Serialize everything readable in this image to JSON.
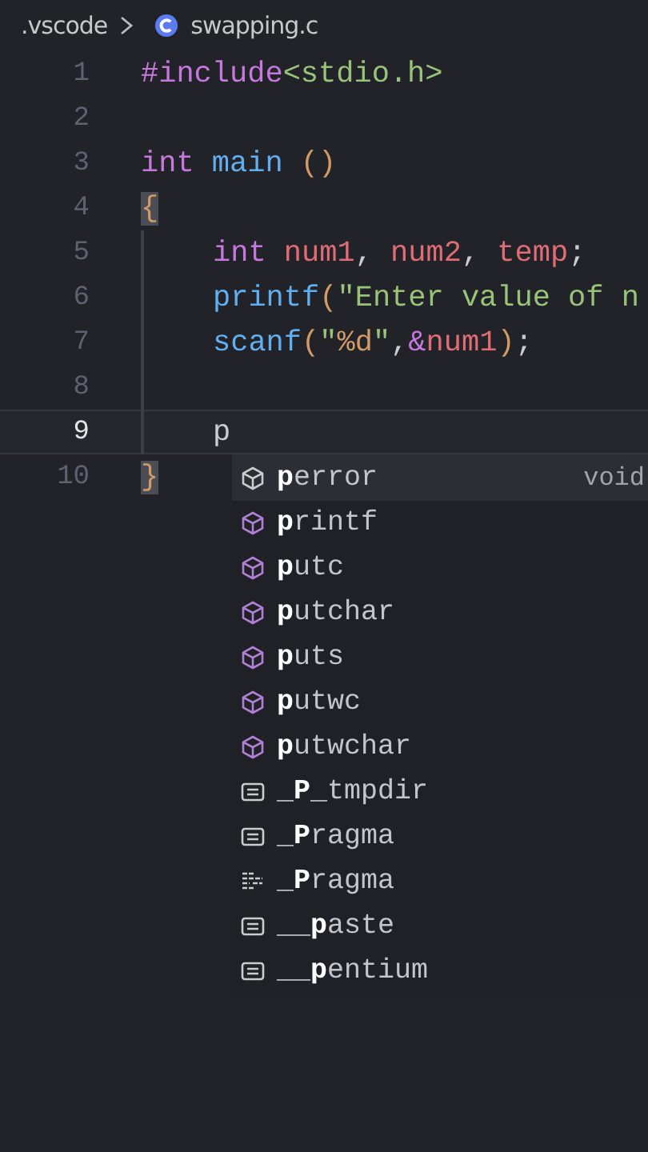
{
  "breadcrumb": [
    {
      "label": ".vscode",
      "kind": "folder"
    },
    {
      "label": "swapping.c",
      "kind": "c-file"
    }
  ],
  "lines": [
    {
      "number": "1",
      "current": false,
      "indented": false,
      "tokens": [
        {
          "text": "#include",
          "kind": "preproc"
        },
        {
          "text": "<stdio.h>",
          "kind": "header"
        }
      ]
    },
    {
      "number": "2",
      "current": false,
      "indented": false
    },
    {
      "number": "3",
      "current": false,
      "indented": false,
      "tokens": [
        {
          "text": "int",
          "kind": "keyword"
        },
        {
          "text": " main",
          "kind": "function"
        },
        {
          "text": " ()",
          "kind": "bracket"
        }
      ]
    },
    {
      "number": "4",
      "current": false,
      "indented": false,
      "tokens": [
        {
          "text": "{",
          "kind": "matched-bracket"
        }
      ]
    },
    {
      "number": "5",
      "current": false,
      "indented": true,
      "tokens": [
        {
          "text": "int",
          "kind": "keyword"
        },
        {
          "text": " num1",
          "kind": "variable"
        },
        {
          "text": ",",
          "kind": "plain"
        },
        {
          "text": " num2",
          "kind": "variable"
        },
        {
          "text": ",",
          "kind": "plain"
        },
        {
          "text": " temp",
          "kind": "variable"
        },
        {
          "text": ";",
          "kind": "plain"
        }
      ]
    },
    {
      "number": "6",
      "current": false,
      "indented": true,
      "tokens": [
        {
          "text": "printf",
          "kind": "function"
        },
        {
          "text": "(",
          "kind": "bracket"
        },
        {
          "text": "\"Enter value of n",
          "kind": "string"
        }
      ]
    },
    {
      "number": "7",
      "current": false,
      "indented": true,
      "tokens": [
        {
          "text": "scanf",
          "kind": "function"
        },
        {
          "text": "(",
          "kind": "bracket"
        },
        {
          "text": "\"",
          "kind": "string"
        },
        {
          "text": "%d",
          "kind": "format"
        },
        {
          "text": "\"",
          "kind": "string"
        },
        {
          "text": ",",
          "kind": "plain"
        },
        {
          "text": "&",
          "kind": "keyword"
        },
        {
          "text": "num1",
          "kind": "variable"
        },
        {
          "text": ")",
          "kind": "bracket"
        },
        {
          "text": ";",
          "kind": "plain"
        }
      ]
    },
    {
      "number": "8",
      "current": false,
      "indented": true
    },
    {
      "number": "9",
      "current": true,
      "indented": true,
      "tokens": [
        {
          "text": "p",
          "kind": "plain"
        }
      ]
    },
    {
      "number": "10",
      "current": false,
      "indented": false,
      "tokens": [
        {
          "text": "}",
          "kind": "matched-bracket"
        }
      ]
    }
  ],
  "suggestions": [
    {
      "label": "**p**error",
      "kind": "function",
      "selected": true,
      "detail": "void"
    },
    {
      "label": "**p**rintf",
      "kind": "function",
      "selected": false
    },
    {
      "label": "**p**utc",
      "kind": "function",
      "selected": false
    },
    {
      "label": "**p**utchar",
      "kind": "function",
      "selected": false
    },
    {
      "label": "**p**uts",
      "kind": "function",
      "selected": false
    },
    {
      "label": "**p**utwc",
      "kind": "function",
      "selected": false
    },
    {
      "label": "**p**utwchar",
      "kind": "function",
      "selected": false
    },
    {
      "label": "_**P**_tmpdir",
      "kind": "macro",
      "selected": false
    },
    {
      "label": "_**P**ragma",
      "kind": "macro",
      "selected": false
    },
    {
      "label": "_**P**ragma",
      "kind": "snippet",
      "selected": false
    },
    {
      "label": "__**p**aste",
      "kind": "macro",
      "selected": false
    },
    {
      "label": "__**p**entium",
      "kind": "macro",
      "selected": false
    }
  ]
}
